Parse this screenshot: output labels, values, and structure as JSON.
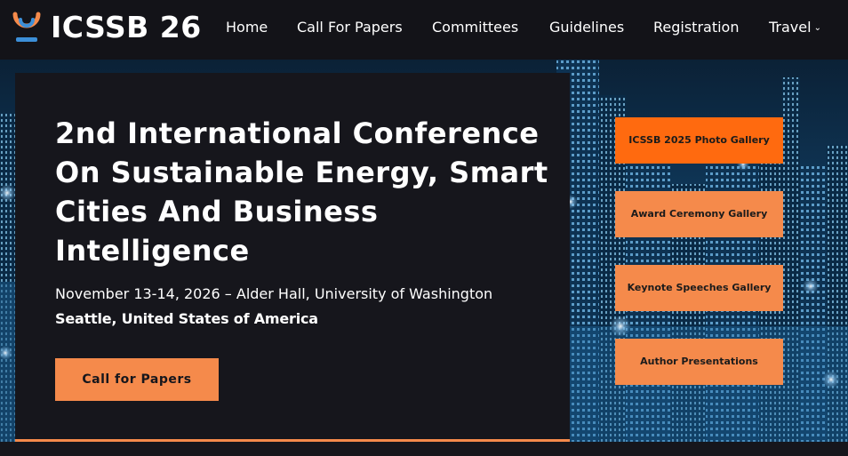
{
  "brand": {
    "name": "ICSSB 26"
  },
  "nav": {
    "items": [
      {
        "label": "Home"
      },
      {
        "label": "Call For Papers"
      },
      {
        "label": "Committees"
      },
      {
        "label": "Guidelines"
      },
      {
        "label": "Registration"
      },
      {
        "label": "Travel"
      }
    ],
    "travel_chevron": "⌄"
  },
  "hero": {
    "title": "2nd International Conference On Sustainable Energy, Smart Cities And Business Intelligence",
    "date_venue": "November 13-14, 2026 – Alder Hall, University of Washington",
    "location": "Seattle, United States of America",
    "cta_label": "Call for Papers"
  },
  "gallery_buttons": [
    {
      "label": "ICSSB 2025 Photo Gallery"
    },
    {
      "label": "Award Ceremony Gallery"
    },
    {
      "label": "Keynote Speeches Gallery"
    },
    {
      "label": "Author Presentations"
    }
  ],
  "colors": {
    "accent": "#f58a4b",
    "accent_active": "#ff6a0f",
    "nav_bg": "#131318",
    "panel_bg": "#16161c",
    "logo_orange": "#f58a4b",
    "logo_blue": "#3c8fd8"
  }
}
